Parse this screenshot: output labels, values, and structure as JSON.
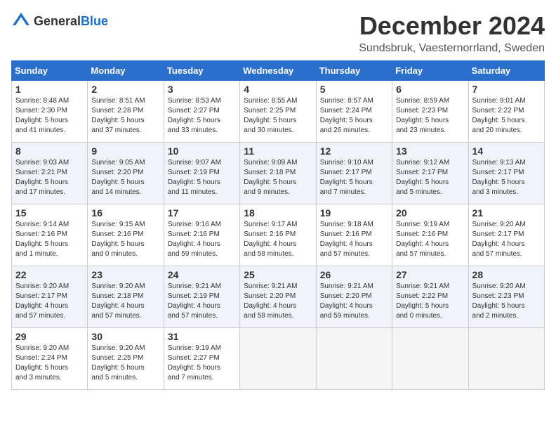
{
  "header": {
    "logo_general": "General",
    "logo_blue": "Blue",
    "title": "December 2024",
    "location": "Sundsbruk, Vaesternorrland, Sweden"
  },
  "weekdays": [
    "Sunday",
    "Monday",
    "Tuesday",
    "Wednesday",
    "Thursday",
    "Friday",
    "Saturday"
  ],
  "weeks": [
    [
      {
        "day": "1",
        "info": "Sunrise: 8:48 AM\nSunset: 2:30 PM\nDaylight: 5 hours\nand 41 minutes."
      },
      {
        "day": "2",
        "info": "Sunrise: 8:51 AM\nSunset: 2:28 PM\nDaylight: 5 hours\nand 37 minutes."
      },
      {
        "day": "3",
        "info": "Sunrise: 8:53 AM\nSunset: 2:27 PM\nDaylight: 5 hours\nand 33 minutes."
      },
      {
        "day": "4",
        "info": "Sunrise: 8:55 AM\nSunset: 2:25 PM\nDaylight: 5 hours\nand 30 minutes."
      },
      {
        "day": "5",
        "info": "Sunrise: 8:57 AM\nSunset: 2:24 PM\nDaylight: 5 hours\nand 26 minutes."
      },
      {
        "day": "6",
        "info": "Sunrise: 8:59 AM\nSunset: 2:23 PM\nDaylight: 5 hours\nand 23 minutes."
      },
      {
        "day": "7",
        "info": "Sunrise: 9:01 AM\nSunset: 2:22 PM\nDaylight: 5 hours\nand 20 minutes."
      }
    ],
    [
      {
        "day": "8",
        "info": "Sunrise: 9:03 AM\nSunset: 2:21 PM\nDaylight: 5 hours\nand 17 minutes."
      },
      {
        "day": "9",
        "info": "Sunrise: 9:05 AM\nSunset: 2:20 PM\nDaylight: 5 hours\nand 14 minutes."
      },
      {
        "day": "10",
        "info": "Sunrise: 9:07 AM\nSunset: 2:19 PM\nDaylight: 5 hours\nand 11 minutes."
      },
      {
        "day": "11",
        "info": "Sunrise: 9:09 AM\nSunset: 2:18 PM\nDaylight: 5 hours\nand 9 minutes."
      },
      {
        "day": "12",
        "info": "Sunrise: 9:10 AM\nSunset: 2:17 PM\nDaylight: 5 hours\nand 7 minutes."
      },
      {
        "day": "13",
        "info": "Sunrise: 9:12 AM\nSunset: 2:17 PM\nDaylight: 5 hours\nand 5 minutes."
      },
      {
        "day": "14",
        "info": "Sunrise: 9:13 AM\nSunset: 2:17 PM\nDaylight: 5 hours\nand 3 minutes."
      }
    ],
    [
      {
        "day": "15",
        "info": "Sunrise: 9:14 AM\nSunset: 2:16 PM\nDaylight: 5 hours\nand 1 minute."
      },
      {
        "day": "16",
        "info": "Sunrise: 9:15 AM\nSunset: 2:16 PM\nDaylight: 5 hours\nand 0 minutes."
      },
      {
        "day": "17",
        "info": "Sunrise: 9:16 AM\nSunset: 2:16 PM\nDaylight: 4 hours\nand 59 minutes."
      },
      {
        "day": "18",
        "info": "Sunrise: 9:17 AM\nSunset: 2:16 PM\nDaylight: 4 hours\nand 58 minutes."
      },
      {
        "day": "19",
        "info": "Sunrise: 9:18 AM\nSunset: 2:16 PM\nDaylight: 4 hours\nand 57 minutes."
      },
      {
        "day": "20",
        "info": "Sunrise: 9:19 AM\nSunset: 2:16 PM\nDaylight: 4 hours\nand 57 minutes."
      },
      {
        "day": "21",
        "info": "Sunrise: 9:20 AM\nSunset: 2:17 PM\nDaylight: 4 hours\nand 57 minutes."
      }
    ],
    [
      {
        "day": "22",
        "info": "Sunrise: 9:20 AM\nSunset: 2:17 PM\nDaylight: 4 hours\nand 57 minutes."
      },
      {
        "day": "23",
        "info": "Sunrise: 9:20 AM\nSunset: 2:18 PM\nDaylight: 4 hours\nand 57 minutes."
      },
      {
        "day": "24",
        "info": "Sunrise: 9:21 AM\nSunset: 2:19 PM\nDaylight: 4 hours\nand 57 minutes."
      },
      {
        "day": "25",
        "info": "Sunrise: 9:21 AM\nSunset: 2:20 PM\nDaylight: 4 hours\nand 58 minutes."
      },
      {
        "day": "26",
        "info": "Sunrise: 9:21 AM\nSunset: 2:20 PM\nDaylight: 4 hours\nand 59 minutes."
      },
      {
        "day": "27",
        "info": "Sunrise: 9:21 AM\nSunset: 2:22 PM\nDaylight: 5 hours\nand 0 minutes."
      },
      {
        "day": "28",
        "info": "Sunrise: 9:20 AM\nSunset: 2:23 PM\nDaylight: 5 hours\nand 2 minutes."
      }
    ],
    [
      {
        "day": "29",
        "info": "Sunrise: 9:20 AM\nSunset: 2:24 PM\nDaylight: 5 hours\nand 3 minutes."
      },
      {
        "day": "30",
        "info": "Sunrise: 9:20 AM\nSunset: 2:25 PM\nDaylight: 5 hours\nand 5 minutes."
      },
      {
        "day": "31",
        "info": "Sunrise: 9:19 AM\nSunset: 2:27 PM\nDaylight: 5 hours\nand 7 minutes."
      },
      {
        "day": "",
        "info": ""
      },
      {
        "day": "",
        "info": ""
      },
      {
        "day": "",
        "info": ""
      },
      {
        "day": "",
        "info": ""
      }
    ]
  ]
}
